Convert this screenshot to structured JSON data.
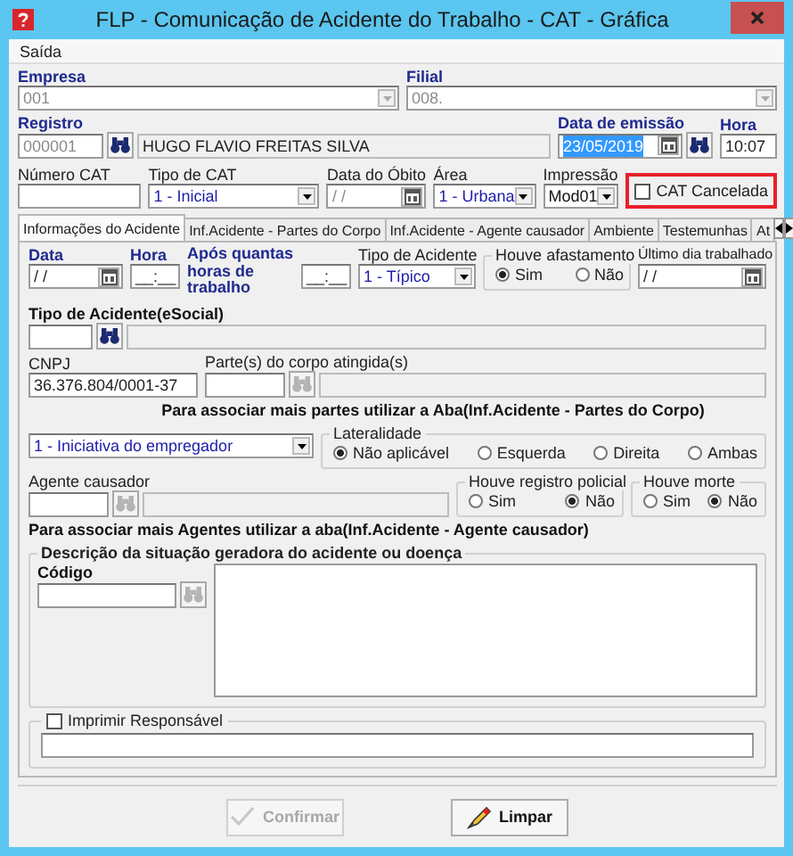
{
  "window": {
    "title": "FLP - Comunicação de Acidente do Trabalho - CAT - Gráfica"
  },
  "menu": [
    {
      "label": "Saída"
    }
  ],
  "empresa": {
    "label": "Empresa",
    "value": "001",
    "disabled": true
  },
  "filial": {
    "label": "Filial",
    "value": "008.",
    "disabled": true
  },
  "registro": {
    "label": "Registro",
    "value": "000001",
    "disabled": true,
    "name": "HUGO FLAVIO FREITAS SILVA"
  },
  "data_emissao": {
    "label": "Data de emissão",
    "value": "23/05/2019",
    "selected": true
  },
  "hora": {
    "label": "Hora",
    "value": "10:07"
  },
  "numero_cat": {
    "label": "Número CAT"
  },
  "tipo_cat": {
    "label": "Tipo de CAT",
    "value": "1 - Inicial"
  },
  "data_obito": {
    "label": "Data do Óbito",
    "value": "/ /",
    "disabled": true
  },
  "area": {
    "label": "Área",
    "value": "1 - Urbana"
  },
  "impressao": {
    "label": "Impressão",
    "value": "Mod01"
  },
  "cat_cancelada": {
    "label": "CAT Cancelada",
    "checked": false,
    "highlighted": true
  },
  "tabs": [
    {
      "label": "Informações do Acidente",
      "selected": true
    },
    {
      "label": "Inf.Acidente - Partes do Corpo",
      "selected": false
    },
    {
      "label": "Inf.Acidente - Agente causador",
      "selected": false
    },
    {
      "label": "Ambiente",
      "selected": false
    },
    {
      "label": "Testemunhas",
      "selected": false
    },
    {
      "label": "At",
      "selected": false
    }
  ],
  "acidente": {
    "data": {
      "label": "Data",
      "value": "/ /"
    },
    "hora": {
      "label": "Hora",
      "value": "__:__"
    },
    "horas_trabalho": {
      "label": "Após quantas horas de trabalho",
      "value": "__:__"
    },
    "tipo": {
      "label": "Tipo de Acidente",
      "value": "1 - Típico"
    },
    "afastamento": {
      "label": "Houve afastamento",
      "options": [
        {
          "label": "Sim",
          "selected": true
        },
        {
          "label": "Não",
          "selected": false
        }
      ]
    },
    "ultimo_dia": {
      "label": "Último dia trabalhado",
      "value": "/ /"
    },
    "tipo_esocial": {
      "label": "Tipo de Acidente(eSocial)",
      "lookup_disabled": false
    },
    "cnpj": {
      "label": "CNPJ",
      "value": "36.376.804/0001-37"
    },
    "partes": {
      "label": "Parte(s) do corpo atingida(s)",
      "lookup_disabled": true
    },
    "partes_note": "Para associar mais partes utilizar a Aba(Inf.Acidente - Partes do Corpo)",
    "iniciativa": {
      "value": "1 - Iniciativa do empregador"
    },
    "lateralidade": {
      "label": "Lateralidade",
      "options": [
        {
          "label": "Não aplicável",
          "selected": true
        },
        {
          "label": "Esquerda",
          "selected": false
        },
        {
          "label": "Direita",
          "selected": false
        },
        {
          "label": "Ambas",
          "selected": false
        }
      ]
    },
    "agente": {
      "label": "Agente causador",
      "lookup_disabled": true
    },
    "registro_policial": {
      "label": "Houve registro policial",
      "options": [
        {
          "label": "Sim",
          "selected": false
        },
        {
          "label": "Não",
          "selected": true
        }
      ]
    },
    "morte": {
      "label": "Houve morte",
      "options": [
        {
          "label": "Sim",
          "selected": false
        },
        {
          "label": "Não",
          "selected": true
        }
      ]
    },
    "agentes_note": "Para associar mais Agentes utilizar a aba(Inf.Acidente - Agente causador)",
    "descricao": {
      "label": "Descrição da situação geradora do acidente ou doença",
      "codigo_label": "Código",
      "lookup_disabled": true
    },
    "responsavel": {
      "label": "Imprimir Responsável",
      "checked": false
    }
  },
  "buttons": [
    {
      "label": "Confirmar",
      "kind": "confirm",
      "disabled": true
    },
    {
      "label": "Limpar",
      "kind": "clear",
      "disabled": false
    }
  ]
}
